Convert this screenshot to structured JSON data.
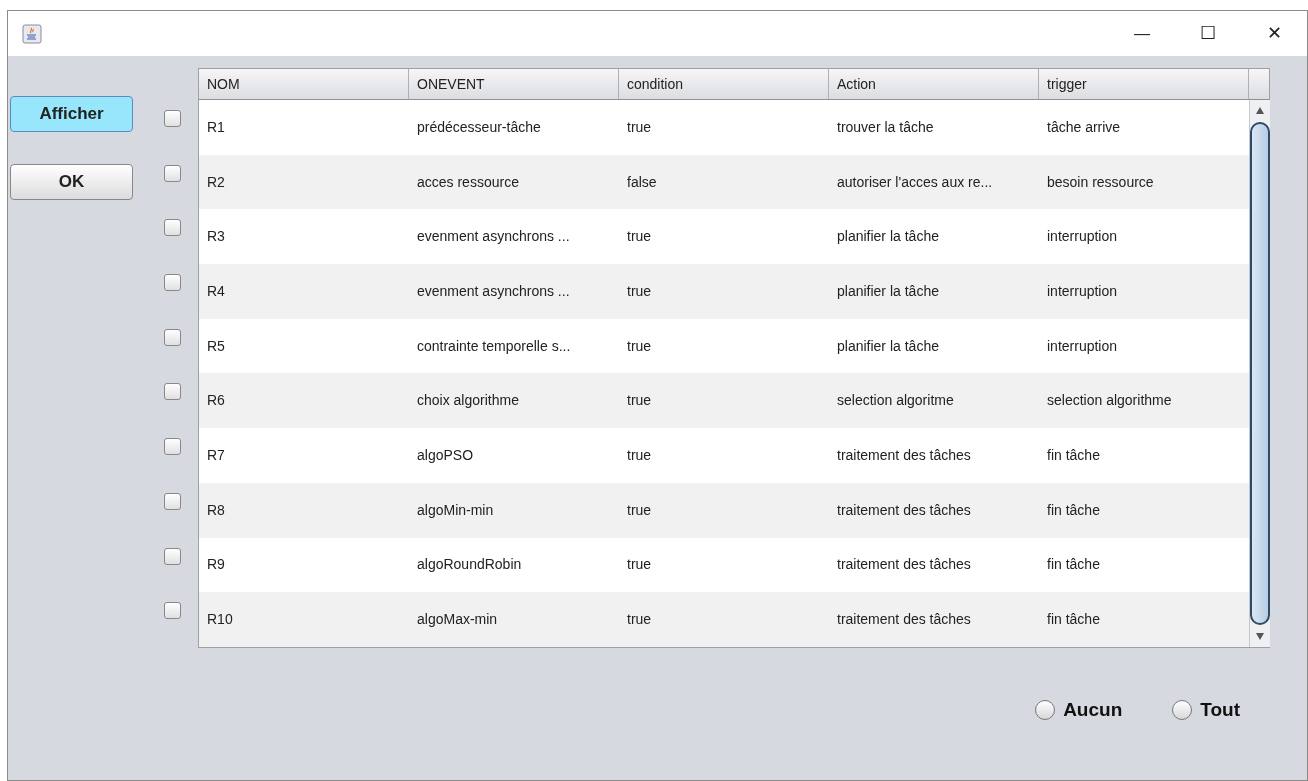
{
  "window": {
    "controls": {
      "minimize": "—",
      "maximize": "☐",
      "close": "✕"
    }
  },
  "buttons": [
    {
      "label": "Afficher",
      "focused": true
    },
    {
      "label": "OK",
      "focused": false
    }
  ],
  "table": {
    "columns": [
      "NOM",
      "ONEVENT",
      "condition",
      "Action",
      "trigger"
    ],
    "rows": [
      {
        "checked": false,
        "cells": [
          "R1",
          "prédécesseur-tâche",
          "true",
          "trouver la tâche",
          "tâche arrive"
        ]
      },
      {
        "checked": false,
        "cells": [
          "R2",
          "acces ressource",
          "false",
          "autoriser l'acces aux re...",
          "besoin ressource"
        ]
      },
      {
        "checked": false,
        "cells": [
          "R3",
          "evenment asynchrons ...",
          "true",
          "planifier la tâche",
          "interruption"
        ]
      },
      {
        "checked": false,
        "cells": [
          "R4",
          "evenment asynchrons ...",
          "true",
          "planifier la tâche",
          "interruption"
        ]
      },
      {
        "checked": false,
        "cells": [
          "R5",
          "contrainte temporelle s...",
          "true",
          "planifier la tâche",
          "interruption"
        ]
      },
      {
        "checked": false,
        "cells": [
          "R6",
          "choix algorithme",
          "true",
          "selection algoritme",
          "selection algorithme"
        ]
      },
      {
        "checked": false,
        "cells": [
          "R7",
          "algoPSO",
          "true",
          "traitement des tâches",
          "fin tâche"
        ]
      },
      {
        "checked": false,
        "cells": [
          "R8",
          "algoMin-min",
          "true",
          "traitement des tâches",
          "fin tâche"
        ]
      },
      {
        "checked": false,
        "cells": [
          "R9",
          "algoRoundRobin",
          "true",
          "traitement des tâches",
          "fin tâche"
        ]
      },
      {
        "checked": false,
        "cells": [
          "R10",
          "algoMax-min",
          "true",
          "traitement des tâches",
          "fin tâche"
        ]
      }
    ]
  },
  "radios": [
    {
      "label": "Aucun",
      "selected": false
    },
    {
      "label": "Tout",
      "selected": false
    }
  ]
}
